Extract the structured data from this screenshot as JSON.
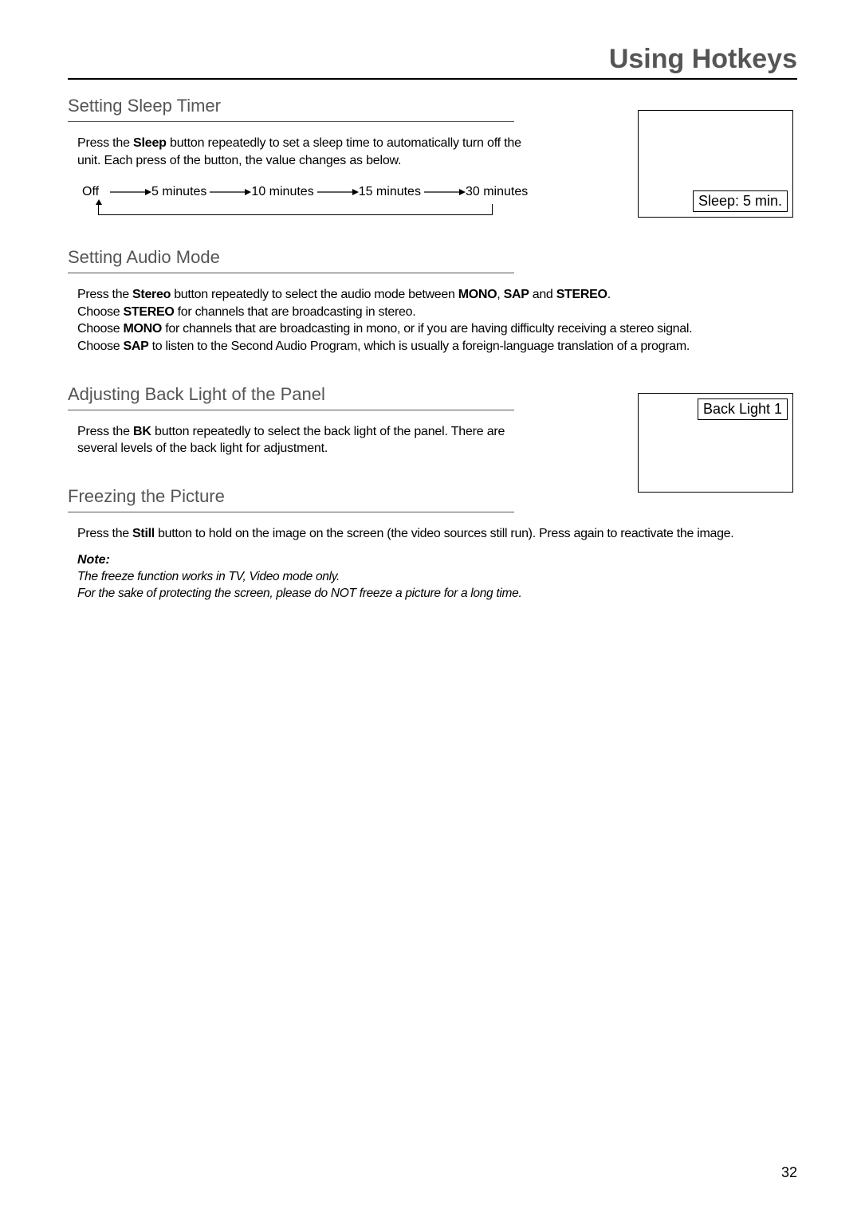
{
  "page_title": "Using Hotkeys",
  "page_number": "32",
  "osd_sleep_label": "Sleep: 5 min.",
  "osd_backlight_label": "Back Light  1",
  "sections": {
    "sleep": {
      "heading": "Setting Sleep Timer",
      "intro_pre": "Press the ",
      "intro_bold": "Sleep",
      "intro_post": " button repeatedly to set a sleep time to automatically turn off the unit. Each press of the button, the value changes as below.",
      "flow": [
        "Off",
        "5 minutes",
        "10 minutes",
        "15 minutes",
        "30 minutes"
      ]
    },
    "audio": {
      "heading": "Setting Audio Mode",
      "l1_pre": "Press the ",
      "l1_b1": "Stereo",
      "l1_mid1": " button repeatedly to select the audio mode between ",
      "l1_b2": "MONO",
      "l1_mid2": ", ",
      "l1_b3": "SAP",
      "l1_mid3": " and ",
      "l1_b4": "STEREO",
      "l1_end": ".",
      "l2_pre": "Choose ",
      "l2_b": "STEREO",
      "l2_post": " for channels that are broadcasting in stereo.",
      "l3_pre": "Choose ",
      "l3_b": "MONO",
      "l3_post": " for channels that are broadcasting in mono, or if you are having difficulty receiving a stereo signal.",
      "l4_pre": "Choose ",
      "l4_b": "SAP",
      "l4_post": " to listen to the Second Audio Program, which is usually a foreign-language translation of a program."
    },
    "backlight": {
      "heading": "Adjusting Back Light of the Panel",
      "l1_pre": "Press the ",
      "l1_b": "BK",
      "l1_post": " button repeatedly to select the back light of the panel. There are several levels of the back light for adjustment."
    },
    "freeze": {
      "heading": "Freezing the Picture",
      "l1_pre": "Press the ",
      "l1_b": "Still",
      "l1_post": " button to hold on the image on the screen (the video sources still run). Press again to reactivate the image.",
      "note_label": "Note:",
      "note_l1": "The freeze function works in TV, Video  mode only.",
      "note_l2": "For the sake of protecting the screen, please do NOT freeze a picture for a long time."
    }
  }
}
